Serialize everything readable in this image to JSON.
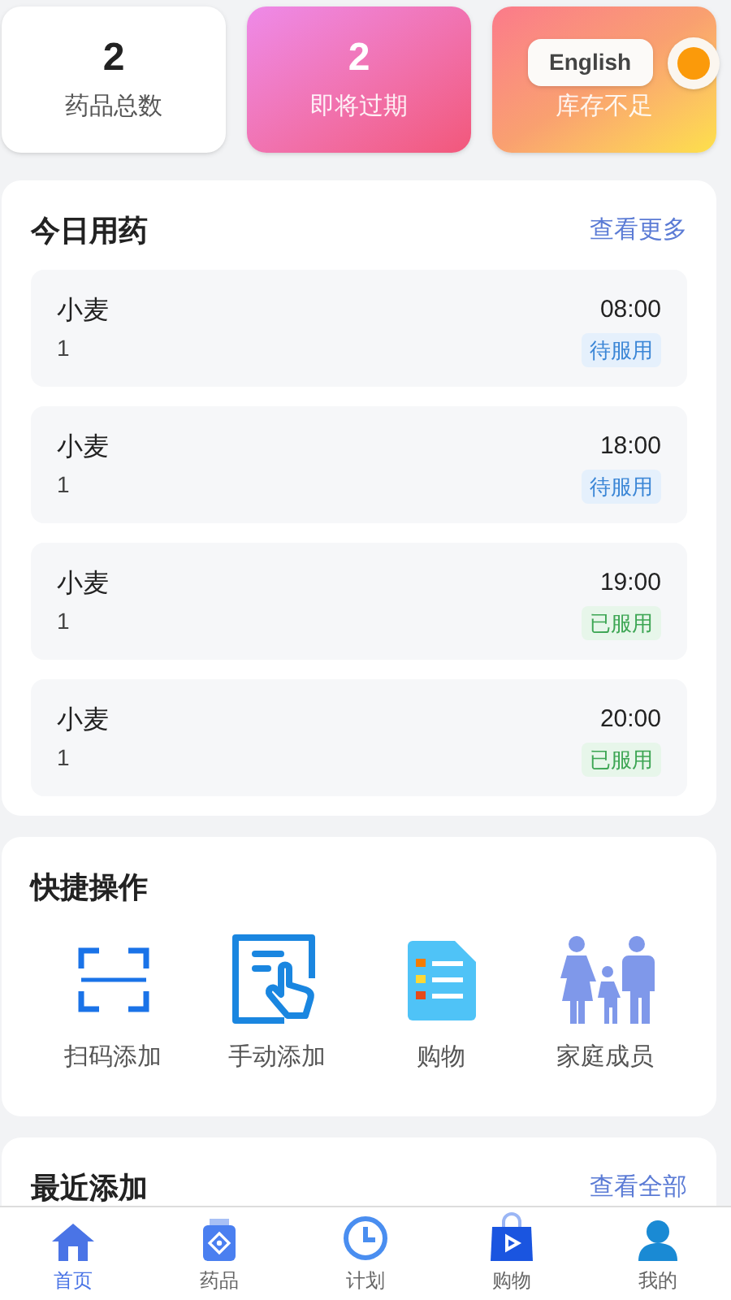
{
  "stats": [
    {
      "value": "2",
      "label": "药品总数",
      "kind": "plain"
    },
    {
      "value": "2",
      "label": "即将过期",
      "kind": "pink"
    },
    {
      "label": "库存不足",
      "kind": "orange"
    }
  ],
  "language_button": {
    "label": "English"
  },
  "today": {
    "title": "今日用药",
    "more": "查看更多",
    "items": [
      {
        "name": "小麦",
        "dose": "1",
        "time": "08:00",
        "status": "待服用",
        "taken": false
      },
      {
        "name": "小麦",
        "dose": "1",
        "time": "18:00",
        "status": "待服用",
        "taken": false
      },
      {
        "name": "小麦",
        "dose": "1",
        "time": "19:00",
        "status": "已服用",
        "taken": true
      },
      {
        "name": "小麦",
        "dose": "1",
        "time": "20:00",
        "status": "已服用",
        "taken": true
      }
    ]
  },
  "quick_actions": {
    "title": "快捷操作",
    "items": [
      {
        "kind": "scan",
        "label": "扫码添加"
      },
      {
        "kind": "manual",
        "label": "手动添加"
      },
      {
        "kind": "shop",
        "label": "购物"
      },
      {
        "kind": "family",
        "label": "家庭成员"
      }
    ]
  },
  "recent": {
    "title": "最近添加",
    "more": "查看全部"
  },
  "tab_bar": [
    {
      "kind": "home",
      "label": "首页",
      "selected": true
    },
    {
      "kind": "medicine",
      "label": "药品",
      "selected": false
    },
    {
      "kind": "plan",
      "label": "计划",
      "selected": false
    },
    {
      "kind": "shop",
      "label": "购物",
      "selected": false
    },
    {
      "kind": "me",
      "label": "我的",
      "selected": false
    }
  ]
}
